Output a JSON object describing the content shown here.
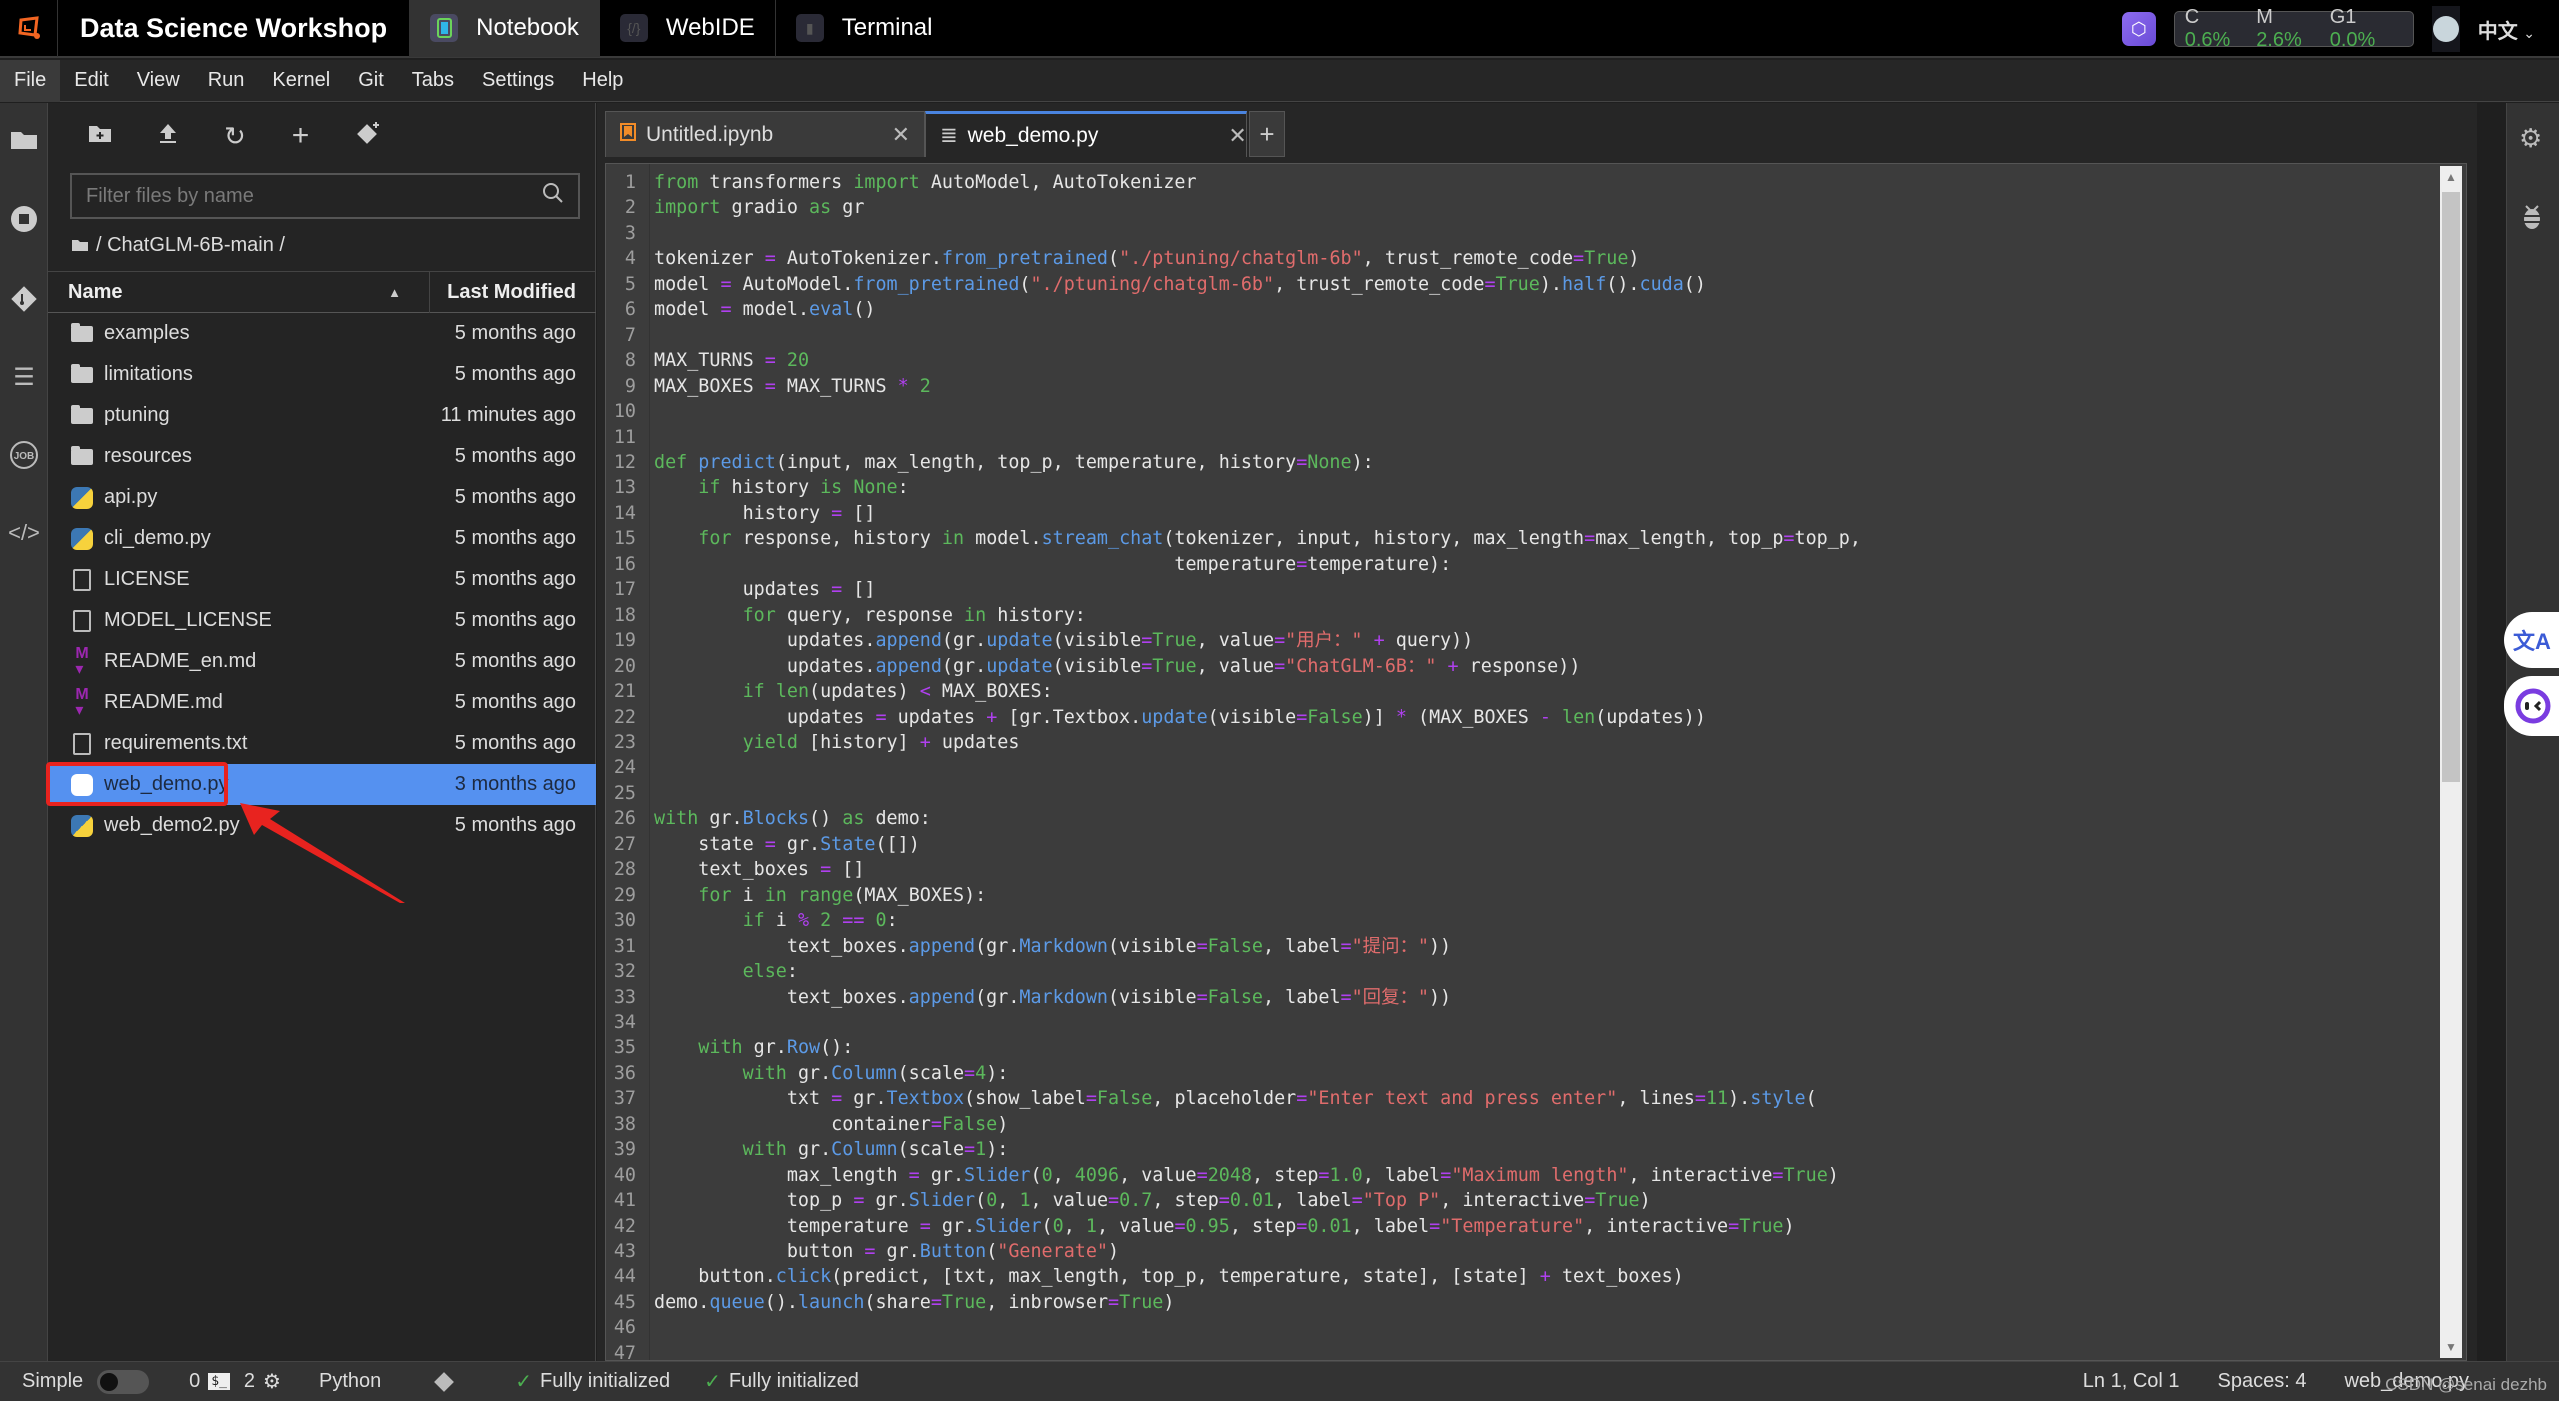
{
  "topbar": {
    "app_title": "Data Science Workshop",
    "tabs": [
      {
        "label": "Notebook",
        "icon": "notebook-icon",
        "active": true
      },
      {
        "label": "WebIDE",
        "icon": "code-braces-icon",
        "active": false
      },
      {
        "label": "Terminal",
        "icon": "terminal-icon",
        "active": false
      }
    ],
    "metrics": {
      "cpu_label": "C",
      "cpu_value": "0.6%",
      "mem_label": "M",
      "mem_value": "2.6%",
      "gpu_label": "G1",
      "gpu_value": "0.0%"
    },
    "language": "中文",
    "colors": {
      "brand": "#f26522",
      "metric_value": "#4caf50"
    }
  },
  "menubar": [
    "File",
    "Edit",
    "View",
    "Run",
    "Kernel",
    "Git",
    "Tabs",
    "Settings",
    "Help"
  ],
  "filebrowser": {
    "filter_placeholder": "Filter files by name",
    "breadcrumb": "/ ChatGLM-6B-main /",
    "columns": {
      "name": "Name",
      "modified": "Last Modified"
    },
    "files": [
      {
        "name": "examples",
        "type": "folder",
        "modified": "5 months ago"
      },
      {
        "name": "limitations",
        "type": "folder",
        "modified": "5 months ago"
      },
      {
        "name": "ptuning",
        "type": "folder",
        "modified": "11 minutes ago"
      },
      {
        "name": "resources",
        "type": "folder",
        "modified": "5 months ago"
      },
      {
        "name": "api.py",
        "type": "python",
        "modified": "5 months ago"
      },
      {
        "name": "cli_demo.py",
        "type": "python",
        "modified": "5 months ago"
      },
      {
        "name": "LICENSE",
        "type": "file",
        "modified": "5 months ago"
      },
      {
        "name": "MODEL_LICENSE",
        "type": "file",
        "modified": "5 months ago"
      },
      {
        "name": "README_en.md",
        "type": "markdown",
        "modified": "5 months ago"
      },
      {
        "name": "README.md",
        "type": "markdown",
        "modified": "5 months ago"
      },
      {
        "name": "requirements.txt",
        "type": "file",
        "modified": "5 months ago"
      },
      {
        "name": "web_demo.py",
        "type": "python",
        "modified": "3 months ago",
        "selected": true
      },
      {
        "name": "web_demo2.py",
        "type": "python",
        "modified": "5 months ago"
      }
    ],
    "selection_color": "#5591f0",
    "annotation_color": "#e8231f"
  },
  "editor": {
    "tabs": [
      {
        "label": "Untitled.ipynb",
        "icon": "notebook-icon",
        "active": false
      },
      {
        "label": "web_demo.py",
        "icon": "text-file-icon",
        "active": true
      }
    ],
    "code_lines": [
      "from transformers import AutoModel, AutoTokenizer",
      "import gradio as gr",
      "",
      "tokenizer = AutoTokenizer.from_pretrained(\"./ptuning/chatglm-6b\", trust_remote_code=True)",
      "model = AutoModel.from_pretrained(\"./ptuning/chatglm-6b\", trust_remote_code=True).half().cuda()",
      "model = model.eval()",
      "",
      "MAX_TURNS = 20",
      "MAX_BOXES = MAX_TURNS * 2",
      "",
      "",
      "def predict(input, max_length, top_p, temperature, history=None):",
      "    if history is None:",
      "        history = []",
      "    for response, history in model.stream_chat(tokenizer, input, history, max_length=max_length, top_p=top_p,",
      "                                               temperature=temperature):",
      "        updates = []",
      "        for query, response in history:",
      "            updates.append(gr.update(visible=True, value=\"用户：\" + query))",
      "            updates.append(gr.update(visible=True, value=\"ChatGLM-6B：\" + response))",
      "        if len(updates) < MAX_BOXES:",
      "            updates = updates + [gr.Textbox.update(visible=False)] * (MAX_BOXES - len(updates))",
      "        yield [history] + updates",
      "",
      "",
      "with gr.Blocks() as demo:",
      "    state = gr.State([])",
      "    text_boxes = []",
      "    for i in range(MAX_BOXES):",
      "        if i % 2 == 0:",
      "            text_boxes.append(gr.Markdown(visible=False, label=\"提问：\"))",
      "        else:",
      "            text_boxes.append(gr.Markdown(visible=False, label=\"回复：\"))",
      "",
      "    with gr.Row():",
      "        with gr.Column(scale=4):",
      "            txt = gr.Textbox(show_label=False, placeholder=\"Enter text and press enter\", lines=11).style(",
      "                container=False)",
      "        with gr.Column(scale=1):",
      "            max_length = gr.Slider(0, 4096, value=2048, step=1.0, label=\"Maximum length\", interactive=True)",
      "            top_p = gr.Slider(0, 1, value=0.7, step=0.01, label=\"Top P\", interactive=True)",
      "            temperature = gr.Slider(0, 1, value=0.95, step=0.01, label=\"Temperature\", interactive=True)",
      "            button = gr.Button(\"Generate\")",
      "    button.click(predict, [txt, max_length, top_p, temperature, state], [state] + text_boxes)",
      "demo.queue().launch(share=True, inbrowser=True)",
      "",
      ""
    ],
    "syntax_colors": {
      "keyword": "#5cb85c",
      "function": "#5c9ae6",
      "string": "#e06c6c",
      "operator": "#b040f0"
    }
  },
  "statusbar": {
    "mode_label": "Simple",
    "terminals_count": "0",
    "kernels_count": "2",
    "kernel_name": "Python",
    "lsp_status_1": "Fully initialized",
    "lsp_status_2": "Fully initialized",
    "cursor": "Ln 1, Col 1",
    "indent": "Spaces: 4",
    "filename": "web_demo.py",
    "watermark": "CSDN @senai dezhb"
  }
}
